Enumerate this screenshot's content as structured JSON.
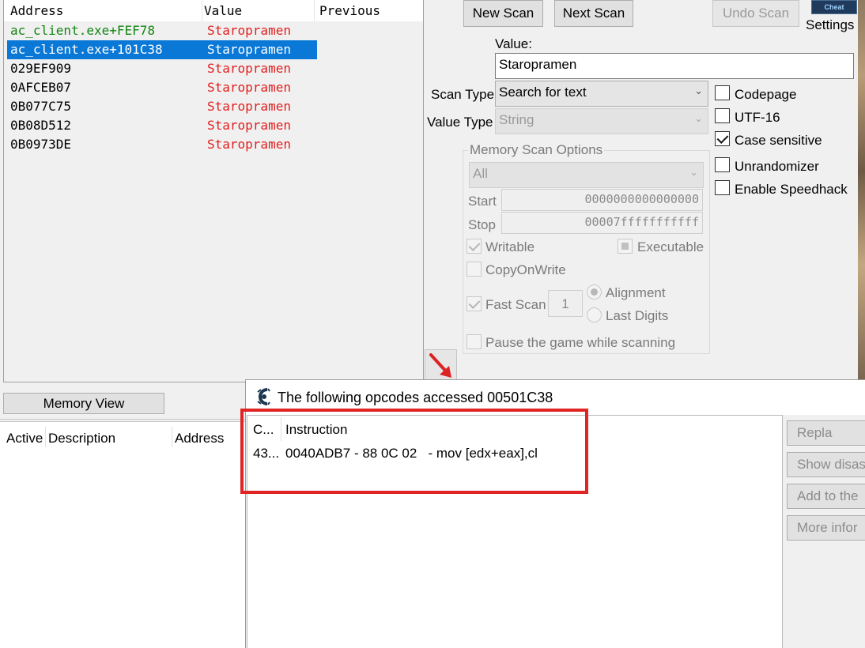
{
  "results": {
    "columns": [
      "Address",
      "Value",
      "Previous"
    ],
    "rows": [
      {
        "address": "ac_client.exe+FEF78",
        "value": "Staropramen",
        "style": "green"
      },
      {
        "address": "ac_client.exe+101C38",
        "value": "Staropramen",
        "style": "selected"
      },
      {
        "address": "029EF909",
        "value": "Staropramen"
      },
      {
        "address": "0AFCEB07",
        "value": "Staropramen"
      },
      {
        "address": "0B077C75",
        "value": "Staropramen"
      },
      {
        "address": "0B08D512",
        "value": "Staropramen"
      },
      {
        "address": "0B0973DE",
        "value": "Staropramen"
      }
    ]
  },
  "toolbar": {
    "new_scan": "New Scan",
    "next_scan": "Next Scan",
    "undo_scan": "Undo Scan",
    "settings": "Settings",
    "logo_text": "Cheat Engine"
  },
  "scan": {
    "value_label": "Value:",
    "value": "Staropramen",
    "scan_type_label": "Scan Type",
    "scan_type": "Search for text",
    "value_type_label": "Value Type",
    "value_type": "String",
    "options": {
      "codepage": {
        "label": "Codepage",
        "checked": false
      },
      "utf16": {
        "label": "UTF-16",
        "checked": false
      },
      "case_sensitive": {
        "label": "Case sensitive",
        "checked": true
      },
      "unrandomizer": {
        "label": "Unrandomizer",
        "checked": false
      },
      "speedhack": {
        "label": "Enable Speedhack",
        "checked": false
      }
    }
  },
  "memory_scan": {
    "title": "Memory Scan Options",
    "region": "All",
    "start_label": "Start",
    "start": "0000000000000000",
    "stop_label": "Stop",
    "stop": "00007fffffffffff",
    "writable": "Writable",
    "executable": "Executable",
    "copy_on_write": "CopyOnWrite",
    "fast_scan": "Fast Scan",
    "fast_scan_value": "1",
    "alignment": "Alignment",
    "last_digits": "Last Digits",
    "pause_game": "Pause the game while scanning"
  },
  "memory_view_button": "Memory View",
  "address_list": {
    "columns": [
      "Active",
      "Description",
      "Address"
    ]
  },
  "popup": {
    "title": "The following opcodes accessed 00501C38",
    "columns": [
      "C...",
      "Instruction"
    ],
    "rows": [
      {
        "count": "43...",
        "instruction": "0040ADB7 - 88 0C 02   - mov [edx+eax],cl"
      }
    ],
    "buttons": [
      "Repla",
      "Show disas",
      "Add to the",
      "More infor"
    ]
  },
  "colors": {
    "selection": "#0a78d7",
    "value_red": "#e21f1f",
    "static_green": "#128512",
    "highlight_box": "#e02424"
  }
}
